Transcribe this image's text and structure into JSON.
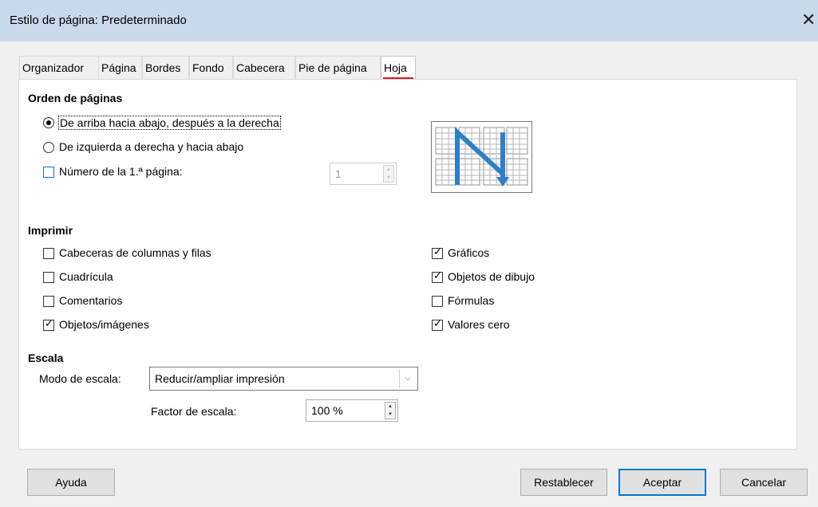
{
  "window": {
    "title": "Estilo de página: Predeterminado",
    "close_glyph": "✕"
  },
  "tabs": [
    {
      "label": "Organizador"
    },
    {
      "label": "Página"
    },
    {
      "label": "Bordes"
    },
    {
      "label": "Fondo"
    },
    {
      "label": "Cabecera"
    },
    {
      "label": "Pie de página"
    },
    {
      "label": "Hoja",
      "active": true
    }
  ],
  "page_order": {
    "title": "Orden de páginas",
    "top_bottom_right": {
      "label": "De arriba hacia abajo, después a la derecha",
      "selected": true
    },
    "left_right_down": {
      "label": "De izquierda a derecha y hacia abajo",
      "selected": false
    },
    "first_page_number": {
      "label": "Número de la 1.ª página:",
      "checked": false,
      "value": "1"
    }
  },
  "print": {
    "title": "Imprimir",
    "left": [
      {
        "label": "Cabeceras de columnas y filas",
        "checked": false
      },
      {
        "label": "Cuadrícula",
        "checked": false
      },
      {
        "label": "Comentarios",
        "checked": false
      },
      {
        "label": "Objetos/imágenes",
        "checked": true
      }
    ],
    "right": [
      {
        "label": "Gráficos",
        "checked": true
      },
      {
        "label": "Objetos de dibujo",
        "checked": true
      },
      {
        "label": "Fórmulas",
        "checked": false
      },
      {
        "label": "Valores cero",
        "checked": true
      }
    ]
  },
  "scale": {
    "title": "Escala",
    "mode_label": "Modo de escala:",
    "mode_value": "Reducir/ampliar impresión",
    "factor_label": "Factor de escala:",
    "factor_value": "100 %"
  },
  "buttons": {
    "help": "Ayuda",
    "reset": "Restablecer",
    "ok": "Aceptar",
    "cancel": "Cancelar"
  },
  "colors": {
    "titlebar": "#c9d9ec",
    "accent": "#0078d7",
    "active_tab_underline": "#e81123",
    "preview_arrow": "#2e7fc9"
  }
}
